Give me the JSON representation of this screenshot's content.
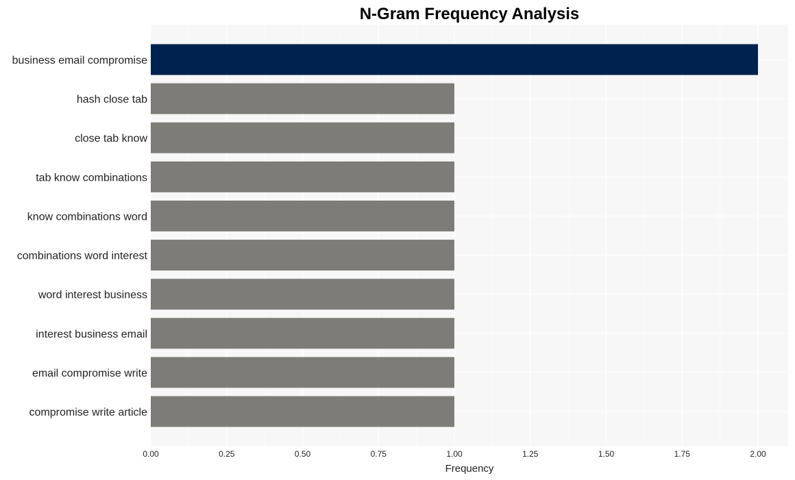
{
  "chart_data": {
    "type": "bar",
    "orientation": "horizontal",
    "title": "N-Gram Frequency Analysis",
    "xlabel": "Frequency",
    "ylabel": "",
    "xlim": [
      0,
      2.1
    ],
    "xticks": [
      "0.00",
      "0.25",
      "0.50",
      "0.75",
      "1.00",
      "1.25",
      "1.50",
      "1.75",
      "2.00"
    ],
    "grid": true,
    "categories": [
      "business email compromise",
      "hash close tab",
      "close tab know",
      "tab know combinations",
      "know combinations word",
      "combinations word interest",
      "word interest business",
      "interest business email",
      "email compromise write",
      "compromise write article"
    ],
    "values": [
      2,
      1,
      1,
      1,
      1,
      1,
      1,
      1,
      1,
      1
    ],
    "colors": {
      "highlight": "#00224e",
      "default": "#7d7c78",
      "plot_background": "#f7f7f7",
      "grid": "#ffffff"
    }
  }
}
